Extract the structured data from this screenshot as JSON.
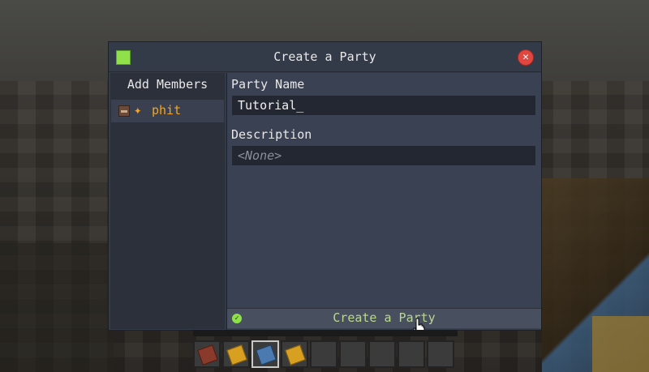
{
  "dialog": {
    "title": "Create a Party",
    "swatch_color": "#8fe04a",
    "close_icon": "close-icon"
  },
  "members": {
    "title": "Add Members",
    "items": [
      {
        "name": "phit",
        "role_icon": "star-icon",
        "color": "#f2a61f"
      }
    ]
  },
  "form": {
    "party_name_label": "Party Name",
    "party_name_value": "Tutorial_",
    "description_label": "Description",
    "description_placeholder": "<None>",
    "create_button_label": "Create a Party"
  },
  "hotbar": {
    "slots": [
      "book",
      "yellow-block",
      "blue-item",
      "yellow-block",
      "",
      "",
      "",
      "",
      ""
    ],
    "selected_index": 2
  }
}
